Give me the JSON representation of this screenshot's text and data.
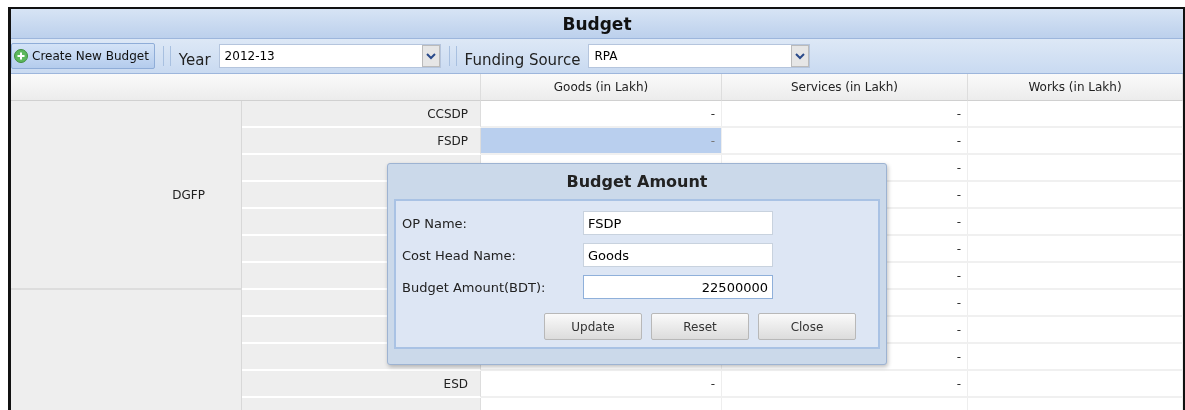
{
  "window": {
    "title": "Budget"
  },
  "toolbar": {
    "create_button": "Create New Budget",
    "year_label": "Year",
    "year_value": "2012-13",
    "funding_label": "Funding Source",
    "funding_value": "RPA"
  },
  "table": {
    "columns": [
      "Goods (in Lakh)",
      "Services (in Lakh)",
      "Works (in Lakh)"
    ],
    "groups": [
      {
        "name": "DGFP",
        "rows": [
          {
            "op": "CCSDP",
            "goods": "-",
            "services": "-",
            "selected": false
          },
          {
            "op": "FSDP",
            "goods": "-",
            "services": "-",
            "selected": true
          },
          {
            "services": "-"
          },
          {
            "services": "-"
          },
          {
            "services": "-"
          },
          {
            "services": "-"
          },
          {
            "services": "-"
          }
        ]
      },
      {
        "rows": [
          {
            "services": "-"
          },
          {
            "services": "-"
          },
          {
            "services": "-"
          },
          {
            "op": "ESD",
            "goods": "-",
            "services": "-",
            "selected": false
          },
          {
            "selected": false
          }
        ]
      }
    ]
  },
  "dialog": {
    "title": "Budget Amount",
    "fields": [
      {
        "label": "OP Name:",
        "value": "FSDP",
        "kind": "text"
      },
      {
        "label": "Cost Head Name:",
        "value": "Goods",
        "kind": "text"
      },
      {
        "label": "Budget Amount(BDT):",
        "value": "22500000",
        "kind": "number"
      }
    ],
    "buttons": [
      "Update",
      "Reset",
      "Close"
    ]
  }
}
